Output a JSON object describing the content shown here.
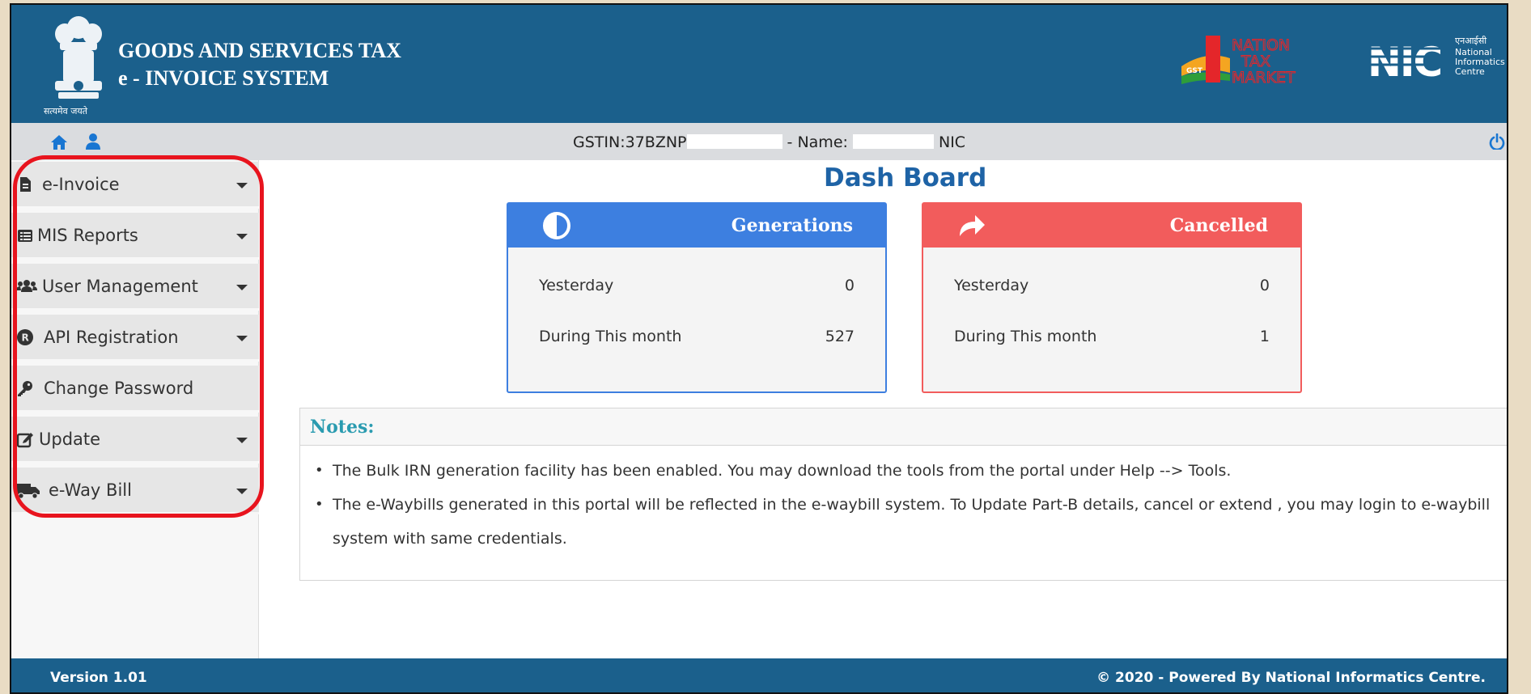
{
  "header": {
    "emblem_caption": "सत्यमेव जयते",
    "title_line1": "GOODS AND SERVICES TAX",
    "title_line2": "e - INVOICE SYSTEM",
    "logo1_text": [
      "NATION",
      "TAX",
      "MARKET"
    ],
    "logo1_badge": "GST",
    "logo2_text": "NIC",
    "logo2_hindi": "एनआईसी",
    "logo2_sub": [
      "National",
      "Informatics",
      "Centre"
    ]
  },
  "infobar": {
    "gstin_prefix": "GSTIN:37BZNP",
    "name_sep": " - Name: ",
    "name_suffix": " NIC",
    "accent": "#1976d2"
  },
  "sidebar": {
    "items": [
      {
        "label": "e-Invoice",
        "icon": "file-icon",
        "has_caret": true
      },
      {
        "label": "MIS Reports",
        "icon": "list-icon",
        "has_caret": true
      },
      {
        "label": "User Management",
        "icon": "users-icon",
        "has_caret": true
      },
      {
        "label": "API Registration",
        "icon": "registered-icon",
        "has_caret": true
      },
      {
        "label": "Change Password",
        "icon": "key-icon",
        "has_caret": false
      },
      {
        "label": "Update",
        "icon": "edit-icon",
        "has_caret": true
      },
      {
        "label": "e-Way Bill",
        "icon": "truck-icon",
        "has_caret": true
      }
    ]
  },
  "dashboard": {
    "title": "Dash Board",
    "generations": {
      "label": "Generations",
      "color": "#3d7fe0",
      "rows": [
        {
          "label": "Yesterday",
          "value": "0"
        },
        {
          "label": "During This month",
          "value": "527"
        }
      ]
    },
    "cancelled": {
      "label": "Cancelled",
      "color": "#f25c5c",
      "rows": [
        {
          "label": "Yesterday",
          "value": "0"
        },
        {
          "label": "During This month",
          "value": "1"
        }
      ]
    }
  },
  "notes": {
    "title": "Notes:",
    "items": [
      "The Bulk IRN generation facility has been enabled. You may download the tools from the portal under Help --> Tools.",
      "The e-Waybills generated in this portal will be reflected in the e-waybill system. To Update Part-B details, cancel or extend , you may login to e-waybill system with same credentials."
    ]
  },
  "footer": {
    "version": "Version 1.01",
    "copyright": "© 2020 - Powered By National Informatics Centre."
  }
}
